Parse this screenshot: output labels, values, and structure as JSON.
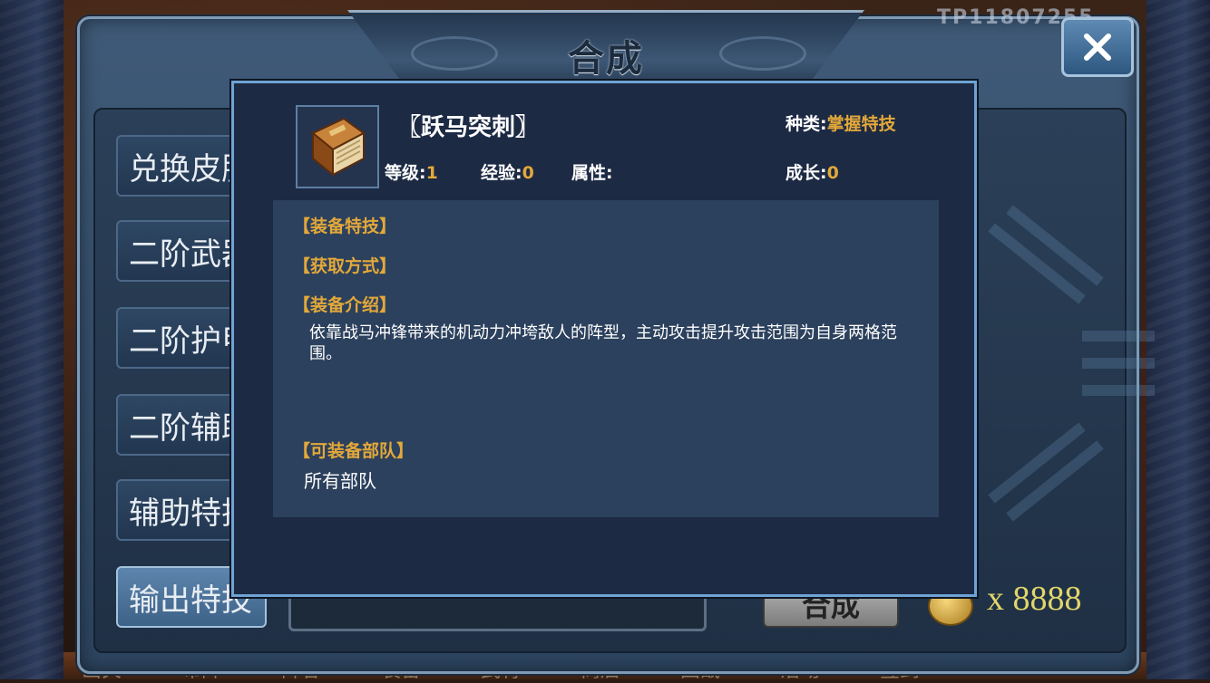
{
  "window": {
    "title": "合成",
    "id_text": "TP11807255",
    "tabs": [
      {
        "label": "兑换皮肤",
        "active": false
      },
      {
        "label": "二阶武器",
        "active": false
      },
      {
        "label": "二阶护甲",
        "active": false
      },
      {
        "label": "二阶辅助",
        "active": false
      },
      {
        "label": "辅助特技",
        "active": false
      },
      {
        "label": "输出特技",
        "active": true
      }
    ],
    "synth_button": "合成",
    "coin_count": "x 8888",
    "bottom_labels": [
      "出关",
      "布阵",
      "阵容",
      "装备",
      "武将",
      "商店",
      "国战",
      "活动",
      "签到"
    ]
  },
  "popup": {
    "item_name": "〖跃马突刺〗",
    "kind_label": "种类:",
    "kind_value": "掌握特技",
    "level_label": "等级:",
    "level_value": "1",
    "exp_label": "经验:",
    "exp_value": "0",
    "attr_label": "属性:",
    "attr_value": "",
    "growth_label": "成长:",
    "growth_value": "0",
    "sections": {
      "equip_skill": "【装备特技】",
      "obtain": "【获取方式】",
      "intro": "【装备介绍】",
      "intro_text": "依靠战马冲锋带来的机动力冲垮敌人的阵型，主动攻击提升攻击范围为自身两格范围。",
      "troops": "【可装备部队】",
      "troops_text": "所有部队"
    }
  },
  "colors": {
    "accent_gold": "#e3a83a",
    "popup_bg": "#1c2a44",
    "popup_border": "#6fa3d4",
    "panel_bg": "#2c415d"
  },
  "icons": {
    "close": "close-x-icon",
    "item": "book-icon",
    "coin": "gold-coin-icon"
  }
}
